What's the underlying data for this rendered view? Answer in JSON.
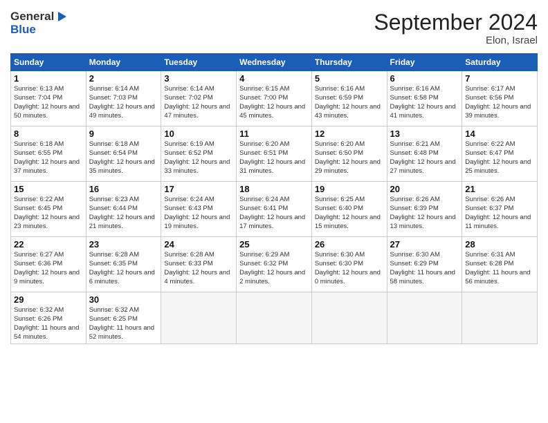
{
  "header": {
    "logo_line1": "General",
    "logo_line2": "Blue",
    "month_title": "September 2024",
    "location": "Elon, Israel"
  },
  "weekdays": [
    "Sunday",
    "Monday",
    "Tuesday",
    "Wednesday",
    "Thursday",
    "Friday",
    "Saturday"
  ],
  "weeks": [
    [
      {
        "day": "1",
        "sunrise": "6:13 AM",
        "sunset": "7:04 PM",
        "daylight": "12 hours and 50 minutes."
      },
      {
        "day": "2",
        "sunrise": "6:14 AM",
        "sunset": "7:03 PM",
        "daylight": "12 hours and 49 minutes."
      },
      {
        "day": "3",
        "sunrise": "6:14 AM",
        "sunset": "7:02 PM",
        "daylight": "12 hours and 47 minutes."
      },
      {
        "day": "4",
        "sunrise": "6:15 AM",
        "sunset": "7:00 PM",
        "daylight": "12 hours and 45 minutes."
      },
      {
        "day": "5",
        "sunrise": "6:16 AM",
        "sunset": "6:59 PM",
        "daylight": "12 hours and 43 minutes."
      },
      {
        "day": "6",
        "sunrise": "6:16 AM",
        "sunset": "6:58 PM",
        "daylight": "12 hours and 41 minutes."
      },
      {
        "day": "7",
        "sunrise": "6:17 AM",
        "sunset": "6:56 PM",
        "daylight": "12 hours and 39 minutes."
      }
    ],
    [
      {
        "day": "8",
        "sunrise": "6:18 AM",
        "sunset": "6:55 PM",
        "daylight": "12 hours and 37 minutes."
      },
      {
        "day": "9",
        "sunrise": "6:18 AM",
        "sunset": "6:54 PM",
        "daylight": "12 hours and 35 minutes."
      },
      {
        "day": "10",
        "sunrise": "6:19 AM",
        "sunset": "6:52 PM",
        "daylight": "12 hours and 33 minutes."
      },
      {
        "day": "11",
        "sunrise": "6:20 AM",
        "sunset": "6:51 PM",
        "daylight": "12 hours and 31 minutes."
      },
      {
        "day": "12",
        "sunrise": "6:20 AM",
        "sunset": "6:50 PM",
        "daylight": "12 hours and 29 minutes."
      },
      {
        "day": "13",
        "sunrise": "6:21 AM",
        "sunset": "6:48 PM",
        "daylight": "12 hours and 27 minutes."
      },
      {
        "day": "14",
        "sunrise": "6:22 AM",
        "sunset": "6:47 PM",
        "daylight": "12 hours and 25 minutes."
      }
    ],
    [
      {
        "day": "15",
        "sunrise": "6:22 AM",
        "sunset": "6:45 PM",
        "daylight": "12 hours and 23 minutes."
      },
      {
        "day": "16",
        "sunrise": "6:23 AM",
        "sunset": "6:44 PM",
        "daylight": "12 hours and 21 minutes."
      },
      {
        "day": "17",
        "sunrise": "6:24 AM",
        "sunset": "6:43 PM",
        "daylight": "12 hours and 19 minutes."
      },
      {
        "day": "18",
        "sunrise": "6:24 AM",
        "sunset": "6:41 PM",
        "daylight": "12 hours and 17 minutes."
      },
      {
        "day": "19",
        "sunrise": "6:25 AM",
        "sunset": "6:40 PM",
        "daylight": "12 hours and 15 minutes."
      },
      {
        "day": "20",
        "sunrise": "6:26 AM",
        "sunset": "6:39 PM",
        "daylight": "12 hours and 13 minutes."
      },
      {
        "day": "21",
        "sunrise": "6:26 AM",
        "sunset": "6:37 PM",
        "daylight": "12 hours and 11 minutes."
      }
    ],
    [
      {
        "day": "22",
        "sunrise": "6:27 AM",
        "sunset": "6:36 PM",
        "daylight": "12 hours and 9 minutes."
      },
      {
        "day": "23",
        "sunrise": "6:28 AM",
        "sunset": "6:35 PM",
        "daylight": "12 hours and 6 minutes."
      },
      {
        "day": "24",
        "sunrise": "6:28 AM",
        "sunset": "6:33 PM",
        "daylight": "12 hours and 4 minutes."
      },
      {
        "day": "25",
        "sunrise": "6:29 AM",
        "sunset": "6:32 PM",
        "daylight": "12 hours and 2 minutes."
      },
      {
        "day": "26",
        "sunrise": "6:30 AM",
        "sunset": "6:30 PM",
        "daylight": "12 hours and 0 minutes."
      },
      {
        "day": "27",
        "sunrise": "6:30 AM",
        "sunset": "6:29 PM",
        "daylight": "11 hours and 58 minutes."
      },
      {
        "day": "28",
        "sunrise": "6:31 AM",
        "sunset": "6:28 PM",
        "daylight": "11 hours and 56 minutes."
      }
    ],
    [
      {
        "day": "29",
        "sunrise": "6:32 AM",
        "sunset": "6:26 PM",
        "daylight": "11 hours and 54 minutes."
      },
      {
        "day": "30",
        "sunrise": "6:32 AM",
        "sunset": "6:25 PM",
        "daylight": "11 hours and 52 minutes."
      },
      null,
      null,
      null,
      null,
      null
    ]
  ]
}
